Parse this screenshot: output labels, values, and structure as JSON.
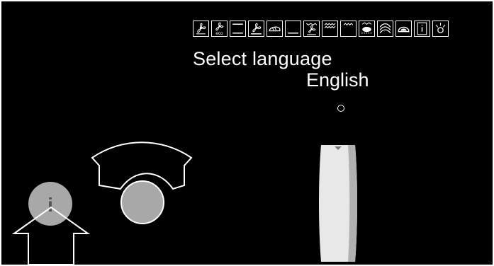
{
  "screen": {
    "title": "Select language",
    "language_value": "English"
  },
  "mode_icons": [
    "fan-heating-icon",
    "eco-fan-heating-icon",
    "top-bottom-heat-icon",
    "fan-bottom-heat-icon",
    "bread-icon",
    "bottom-heat-icon",
    "grill-fan-icon",
    "full-grill-icon",
    "half-grill-icon",
    "defrost-tray-icon",
    "steam-icon",
    "slow-cook-icon",
    "door-info-icon",
    "oven-light-icon"
  ],
  "info_button": {
    "label": "i"
  },
  "colors": {
    "background": "#000000",
    "foreground": "#ffffff",
    "knob": "#a8a8a8",
    "scroll_handle": "#e6e6e6"
  }
}
